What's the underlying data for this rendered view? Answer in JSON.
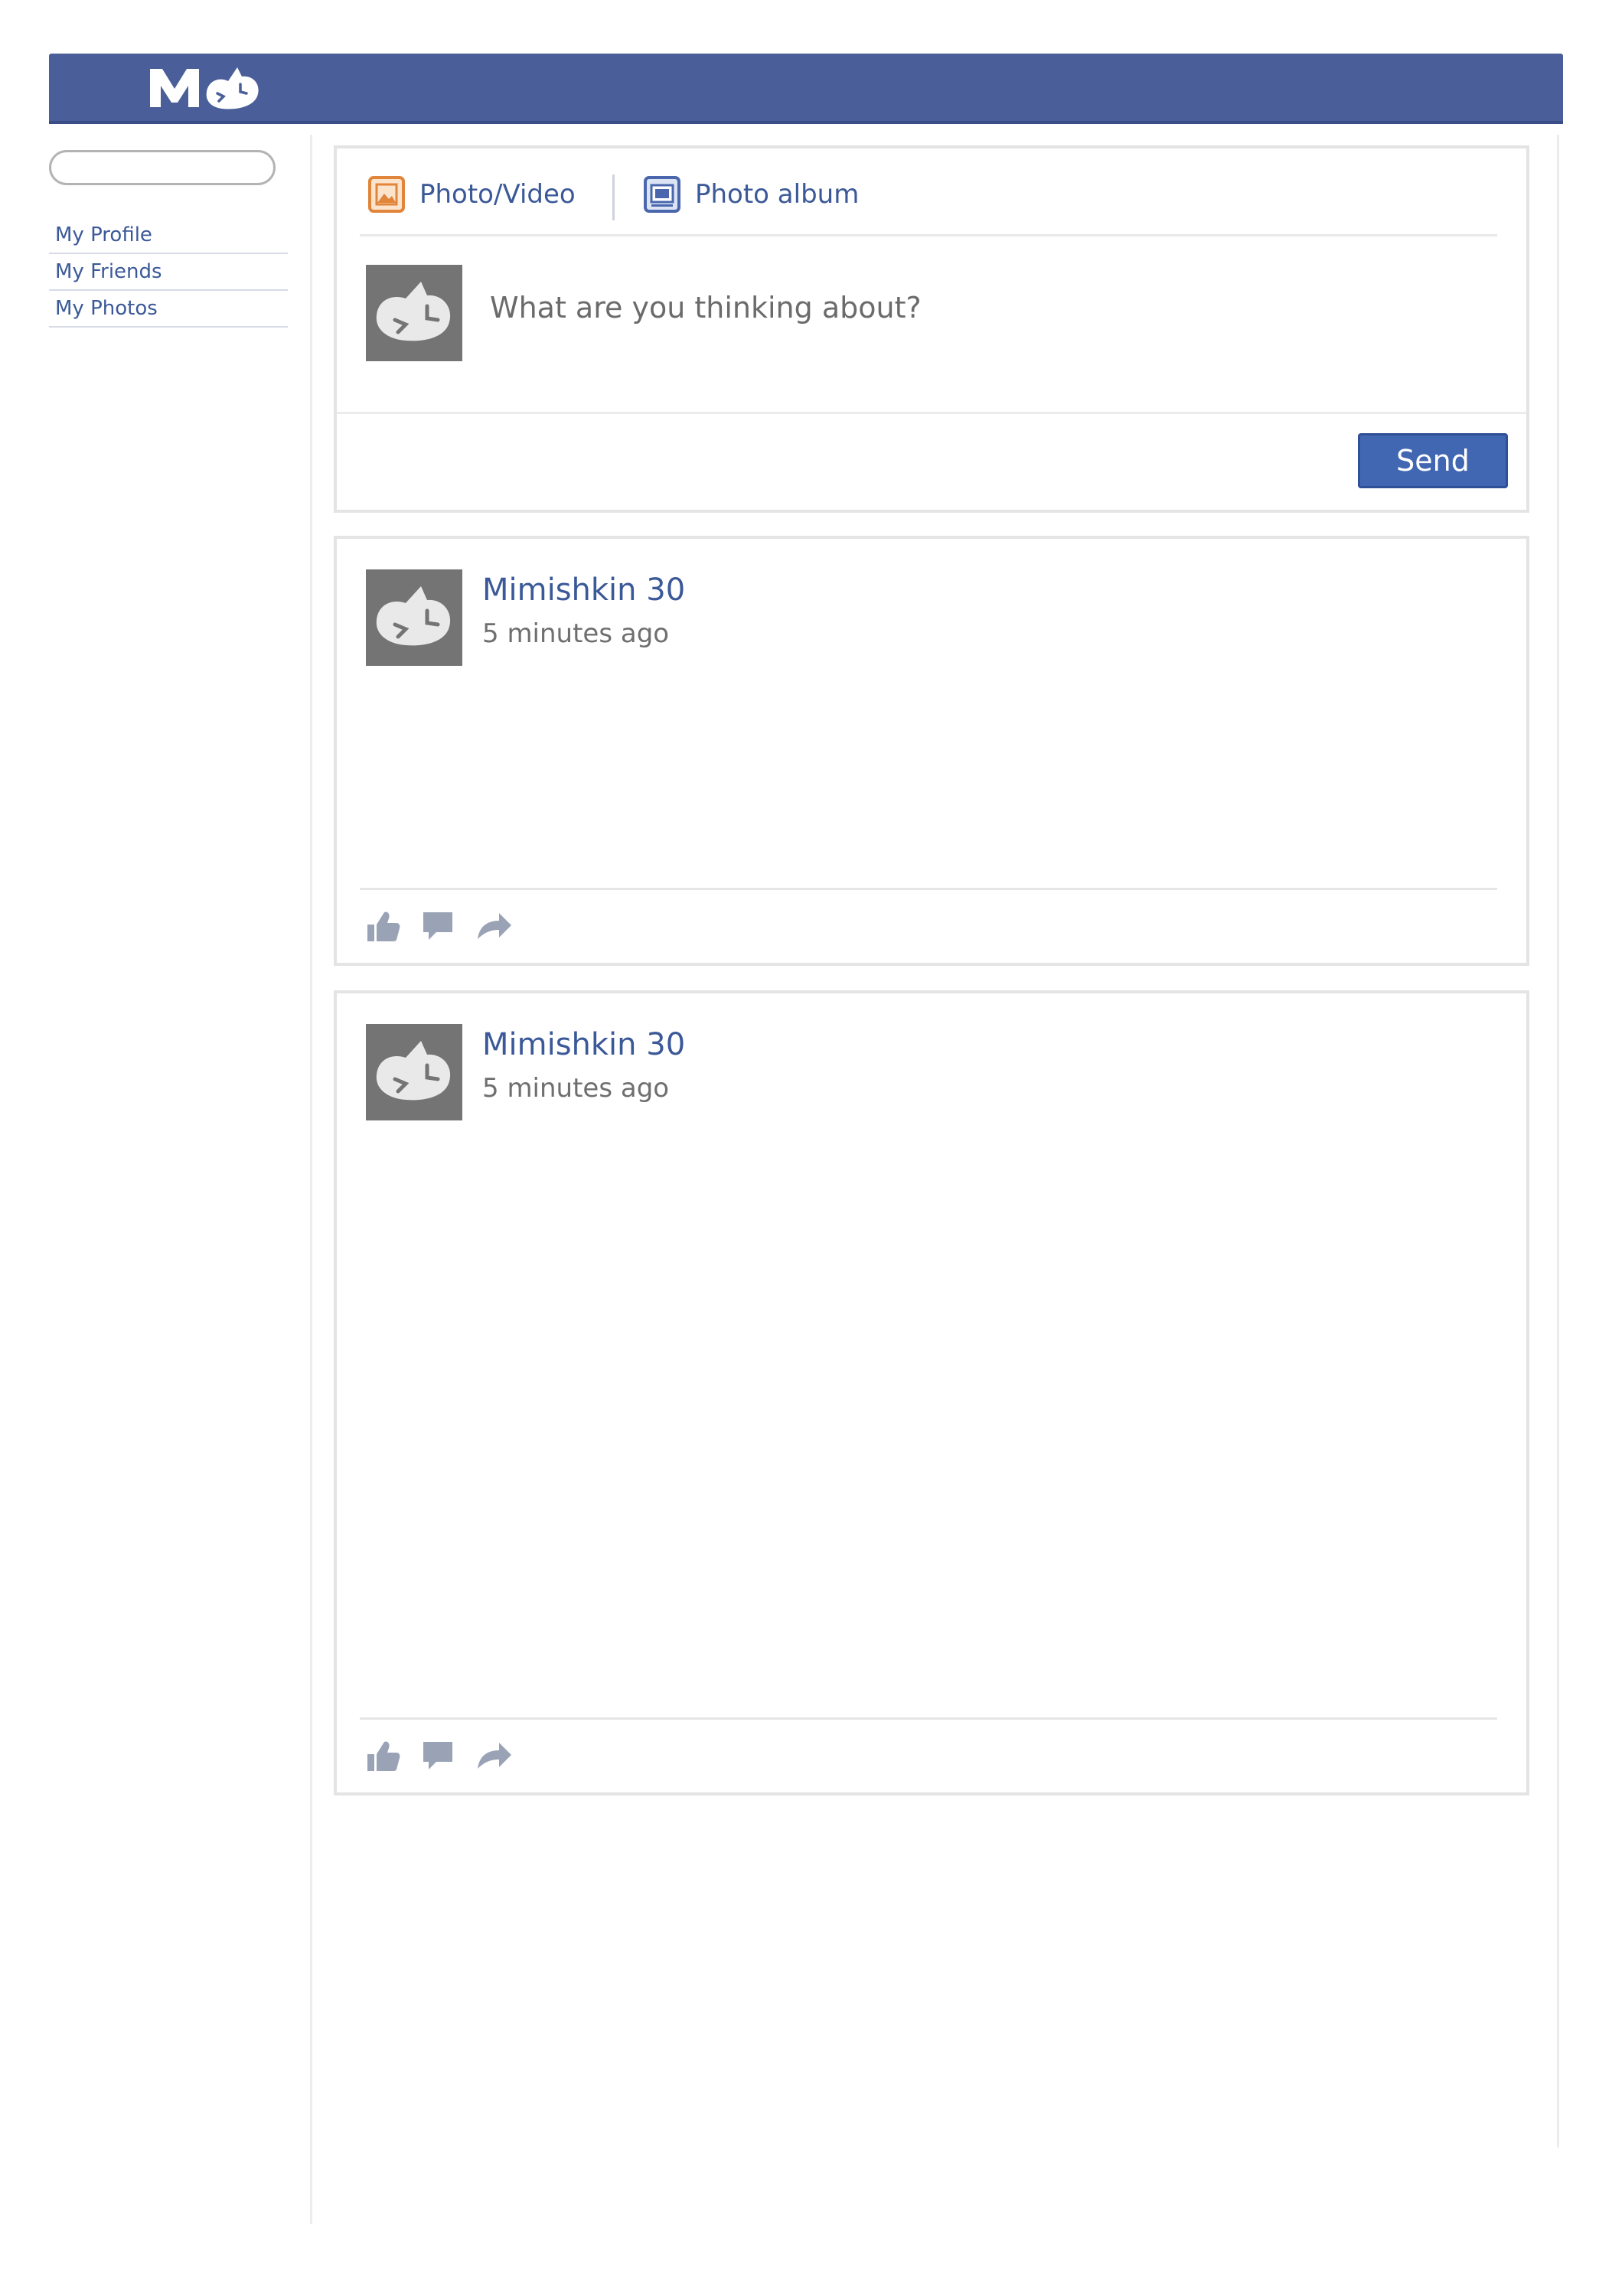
{
  "header": {
    "logo_icon": "mimishkin-cat-logo",
    "brand_color": "#4a5e99"
  },
  "sidebar": {
    "search": {
      "placeholder": ""
    },
    "items": [
      {
        "label": "My Profile"
      },
      {
        "label": "My Friends"
      },
      {
        "label": "My Photos"
      }
    ]
  },
  "composer": {
    "tabs": [
      {
        "label": "Photo/Video",
        "icon": "photo-video-icon"
      },
      {
        "label": "Photo album",
        "icon": "photo-album-icon"
      }
    ],
    "prompt": "What are you thinking about?",
    "send_label": "Send",
    "avatar_icon": "cat-avatar"
  },
  "posts": [
    {
      "author": "Mimishkin 30",
      "time": "5 minutes ago",
      "actions": [
        "like-icon",
        "comment-icon",
        "share-icon"
      ]
    },
    {
      "author": "Mimishkin 30",
      "time": "5 minutes ago",
      "actions": [
        "like-icon",
        "comment-icon",
        "share-icon"
      ]
    }
  ],
  "colors": {
    "link": "#3b5998",
    "button": "#4267b2",
    "avatar_bg": "#747474",
    "photo_icon": "#e0853a"
  }
}
